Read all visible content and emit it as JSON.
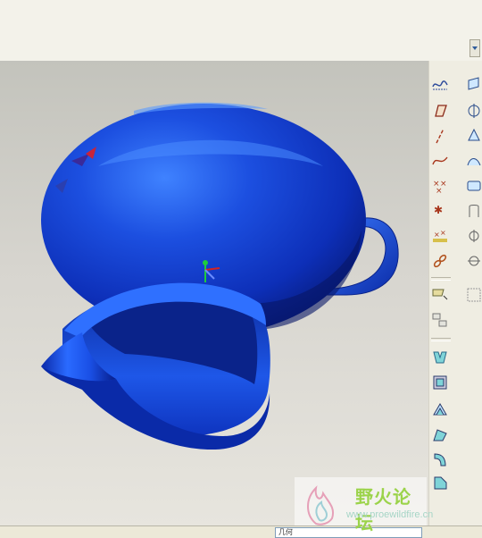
{
  "app": {
    "toolbar": {
      "tools": [
        {
          "name": "sketch-tool"
        },
        {
          "name": "surface-patch-tool"
        },
        {
          "name": "datum-plane-tool"
        },
        {
          "name": "datum-axis-tool"
        },
        {
          "name": "datum-axis-tool-2"
        },
        {
          "name": "style-tool"
        },
        {
          "name": "datum-curve-tool"
        },
        {
          "name": "fill-tool"
        },
        {
          "name": "datum-point-tool"
        },
        {
          "name": "boundary-tool"
        },
        {
          "name": "datum-coordsys-tool"
        },
        {
          "name": "merge-tool"
        },
        {
          "name": "analysis-tool"
        },
        {
          "name": "trim-tool"
        },
        {
          "name": "chain-tool"
        },
        {
          "name": "pattern-tool"
        },
        {
          "name": "copy-feature-tool"
        },
        {
          "name": "mirror-tool"
        },
        {
          "name": "extrude-tool"
        },
        {
          "name": "revolve-tool"
        },
        {
          "name": "sweep-tool"
        },
        {
          "name": "blend-tool"
        },
        {
          "name": "round-tool"
        },
        {
          "name": "chamfer-tool"
        }
      ]
    },
    "status": {
      "field_text": "几何"
    },
    "watermark": {
      "title": "野火论坛",
      "url": "www.proewildfire.cn"
    },
    "colors": {
      "model_blue": "#1c4fe0",
      "axis_green": "#1ecc3c",
      "axis_red": "#d42323",
      "toolbar_bg": "#efede2"
    }
  }
}
